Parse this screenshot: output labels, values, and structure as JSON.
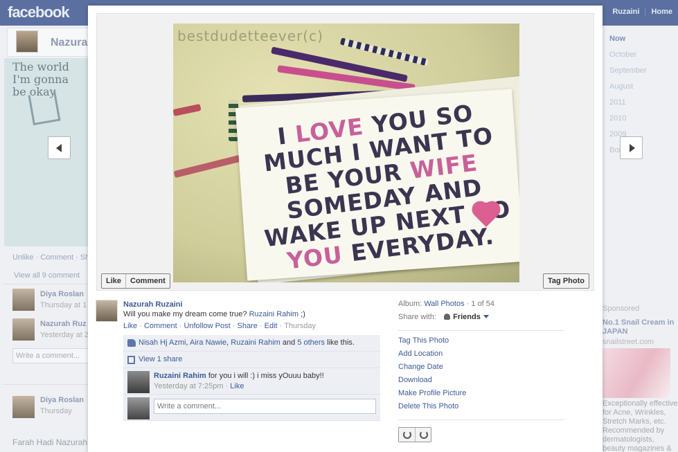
{
  "header": {
    "logo": "facebook",
    "user_nav": "Ruzaini",
    "home": "Home"
  },
  "background": {
    "profile_name": "Nazurah",
    "photo_text": "The world I'm gonna be okay",
    "unlike_row": "Unlike · Comment · Sha",
    "view_comments": "View all 9 comment",
    "comment1_name": "Diya Roslan",
    "comment1_time": "Thursday at 1",
    "comment2_name": "Nazurah Ruz",
    "comment2_time": "Yesterday at 2",
    "write_comment": "Write a comment...",
    "post2_name": "Diya Roslan",
    "post2_time": "Thursday",
    "post2_text": "Farah Hadi Nazurah",
    "timeline": [
      "Now",
      "October",
      "September",
      "August",
      "2011",
      "2010",
      "2009",
      "Born"
    ],
    "sponsored": "Sponsored",
    "ad_title": "No.1 Snail Cream in JAPAN",
    "ad_url": "snailstreet.com",
    "ad_copy": "Exceptionally effective for Acne, Wrinkles, Stretch Marks, etc. Recommended by dermatologists, beauty magazines & talk shows"
  },
  "photo": {
    "watermark": "bestdudetteever(c)",
    "card_line1a": "I ",
    "card_love": "LOVE",
    "card_line1b": " YOU SO MUCH I WANT TO BE YOUR ",
    "card_wife": "WIFE",
    "card_line2": " SOMEDAY AND WAKE UP NEXT TO ",
    "card_you": "YOU",
    "card_line3": " EVERYDAY.",
    "like_button": "Like",
    "comment_button": "Comment",
    "tag_button": "Tag Photo"
  },
  "post": {
    "author": "Nazurah Ruzaini",
    "text": "Will you make my dream come true?",
    "mention": "Ruzaini Rahim",
    "text_suffix": " ;)",
    "actions": {
      "like": "Like",
      "comment": "Comment",
      "unfollow": "Unfollow Post",
      "share": "Share",
      "edit": "Edit",
      "time": "Thursday"
    },
    "likes": {
      "name1": "Nisah Hj Azmi",
      "name2": "Aira Nawie",
      "name3": "Ruzaini Rahim",
      "connector": "and",
      "others": "5 others",
      "suffix": "like this."
    },
    "view_share": "View 1 share",
    "comment": {
      "author": "Ruzaini Rahim",
      "text": "for you i will :) i miss yOuuu baby!!",
      "time": "Yesterday at 7:25pm",
      "like": "Like"
    },
    "write_placeholder": "Write a comment..."
  },
  "side": {
    "album_label": "Album:",
    "album_name": "Wall Photos",
    "album_count": "1 of 54",
    "share_label": "Share with:",
    "share_value": "Friends",
    "links": [
      "Tag This Photo",
      "Add Location",
      "Change Date",
      "Download",
      "Make Profile Picture",
      "Delete This Photo"
    ]
  }
}
